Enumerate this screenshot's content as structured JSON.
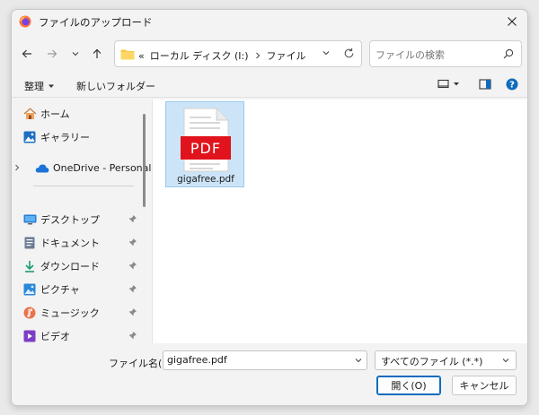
{
  "window": {
    "title": "ファイルのアップロード"
  },
  "address": {
    "prefix": "«",
    "drive": "ローカル ディスク (I:)",
    "folder": "ファイル"
  },
  "search": {
    "placeholder": "ファイルの検索"
  },
  "toolbar": {
    "organize": "整理",
    "new_folder": "新しいフォルダー"
  },
  "sidebar": {
    "items": [
      {
        "label": "ホーム",
        "icon": "home-icon"
      },
      {
        "label": "ギャラリー",
        "icon": "gallery-icon"
      },
      {
        "label": "OneDrive - Personal",
        "icon": "cloud-icon"
      },
      {
        "label": "デスクトップ",
        "icon": "desktop-icon"
      },
      {
        "label": "ドキュメント",
        "icon": "document-icon"
      },
      {
        "label": "ダウンロード",
        "icon": "download-icon"
      },
      {
        "label": "ピクチャ",
        "icon": "pictures-icon"
      },
      {
        "label": "ミュージック",
        "icon": "music-icon"
      },
      {
        "label": "ビデオ",
        "icon": "video-icon"
      }
    ]
  },
  "files": [
    {
      "name": "gigafree.pdf",
      "badge": "PDF"
    }
  ],
  "footer": {
    "filename_label": "ファイル名(N):",
    "filename_value": "gigafree.pdf",
    "filetype_value": "すべてのファイル (*.*)",
    "open_label": "開く(O)",
    "cancel_label": "キャンセル"
  },
  "colors": {
    "accent": "#0f6cbd",
    "pdf_red": "#e1131c",
    "selection": "#cce4f7"
  }
}
